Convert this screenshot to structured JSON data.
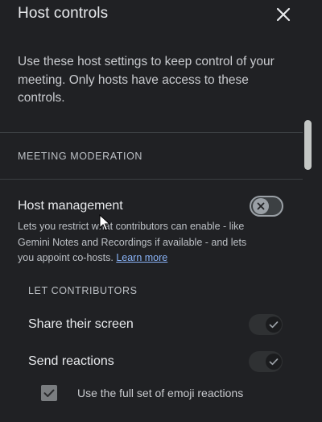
{
  "header": {
    "title": "Host controls",
    "close_icon": "close-icon"
  },
  "intro": {
    "text": "Use these host settings to keep control of your meeting. Only hosts have access to these controls."
  },
  "meeting_moderation": {
    "section_label": "MEETING MODERATION",
    "host_management": {
      "title": "Host management",
      "description": "Lets you restrict what contributors can enable - like Gemini Notes and Recordings if available - and lets you appoint co-hosts.",
      "learn_more": "Learn more",
      "enabled": false
    }
  },
  "let_contributors": {
    "section_label": "LET CONTRIBUTORS",
    "items": [
      {
        "label": "Share their screen",
        "enabled": true
      },
      {
        "label": "Send reactions",
        "enabled": true
      }
    ],
    "emoji_option": {
      "label": "Use the full set of emoji reactions",
      "checked": true
    }
  },
  "colors": {
    "background": "#202124",
    "text": "#e8eaed",
    "link": "#8ab4f8",
    "divider": "#3c4043"
  }
}
